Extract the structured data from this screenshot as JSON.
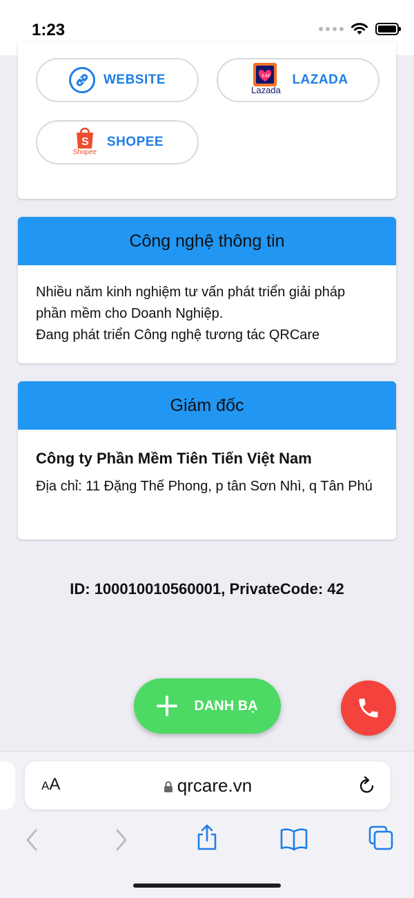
{
  "status_bar": {
    "time": "1:23"
  },
  "links": [
    {
      "label": "WEBSITE"
    },
    {
      "label": "LAZADA",
      "brand_text": "Lazada"
    },
    {
      "label": "SHOPEE",
      "brand_text": "Shopee"
    }
  ],
  "card_it": {
    "title": "Công nghệ thông tin",
    "body": "Nhiều năm kinh nghiệm tư vấn phát triển giải pháp phần mềm cho Doanh  Nghiệp.\nĐang phát triển Công nghệ tương tác QRCare"
  },
  "card_director": {
    "title": "Giám đốc",
    "company": "Công ty Phần Mềm Tiên Tiến Việt Nam",
    "address": "Địa chỉ: 11 Đặng Thế Phong, p tân Sơn Nhì, q Tân Phú"
  },
  "id_line": "ID: 100010010560001, PrivateCode: 42",
  "fab": {
    "contacts_label": "DANH BẠ"
  },
  "browser": {
    "aa_small": "A",
    "aa_large": "A",
    "url": "qrcare.vn"
  },
  "colors": {
    "accent_blue": "#2196f3",
    "link_blue": "#1e7ee6",
    "contacts_green": "#4cd964",
    "call_red": "#f4433c"
  }
}
